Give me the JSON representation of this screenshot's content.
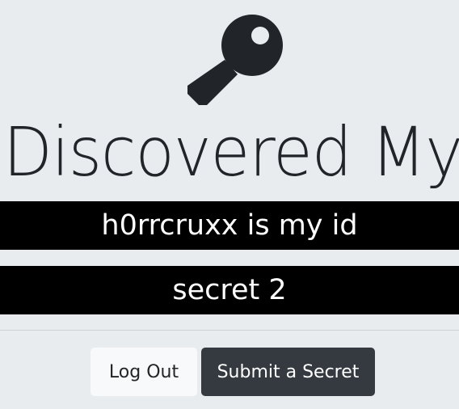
{
  "page": {
    "heading": "Discovered My"
  },
  "secrets": [
    {
      "text": "h0rrcruxx is my id"
    },
    {
      "text": "secret 2"
    }
  ],
  "actions": {
    "logout_label": "Log Out",
    "submit_label": "Submit a Secret"
  },
  "icons": {
    "hero": "key-icon"
  },
  "colors": {
    "background": "#e9ecef",
    "text": "#212529",
    "secret_bar": "#000000",
    "secret_text": "#ffffff",
    "light_button": "#f8f9fa",
    "dark_button": "#343a40"
  }
}
